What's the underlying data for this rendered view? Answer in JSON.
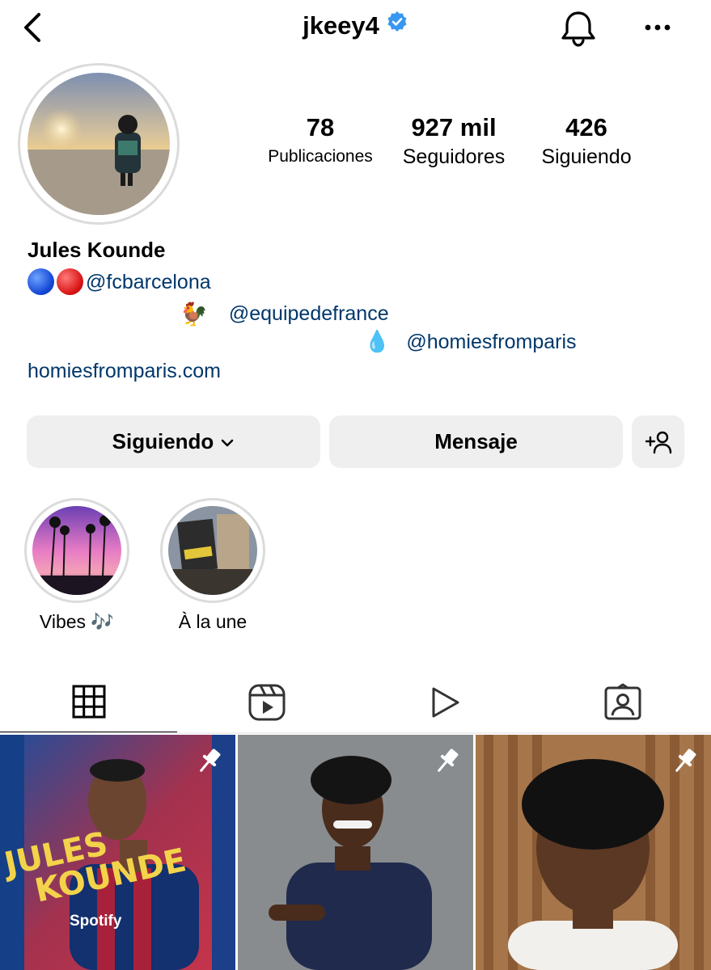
{
  "header": {
    "username": "jkeey4",
    "back_icon": "chevron-left-icon",
    "verified_icon": "verified-badge-icon",
    "bell_icon": "bell-icon",
    "more_icon": "more-horizontal-icon"
  },
  "stats": {
    "posts_count": "78",
    "posts_label": "Publicaciones",
    "followers_count": "927 mil",
    "followers_label": "Seguidores",
    "following_count": "426",
    "following_label": "Siguiendo"
  },
  "bio": {
    "name": "Jules Kounde",
    "line1_handle": "@fcbarcelona",
    "line2_emoji": "🐓",
    "line2_handle": "@equipedefrance",
    "line3_emoji": "💧",
    "line3_handle": "@homiesfromparis",
    "link": "homiesfromparis.com"
  },
  "actions": {
    "following_label": "Siguiendo",
    "message_label": "Mensaje",
    "add_user_icon": "add-user-icon"
  },
  "highlights": [
    {
      "label": "Vibes 🎶"
    },
    {
      "label": "À la une"
    }
  ],
  "tabs": [
    {
      "icon": "grid-icon",
      "active": true
    },
    {
      "icon": "reels-icon",
      "active": false
    },
    {
      "icon": "play-icon",
      "active": false
    },
    {
      "icon": "tagged-icon",
      "active": false
    }
  ],
  "posts": {
    "pin_icon": "pin-icon",
    "post1_text_line1": "JULES",
    "post1_text_line2": "KOUNDE",
    "post1_sponsor": "Spotify"
  },
  "colors": {
    "link": "#00376b",
    "button_bg": "#efefef",
    "verified": "#3897f0"
  }
}
